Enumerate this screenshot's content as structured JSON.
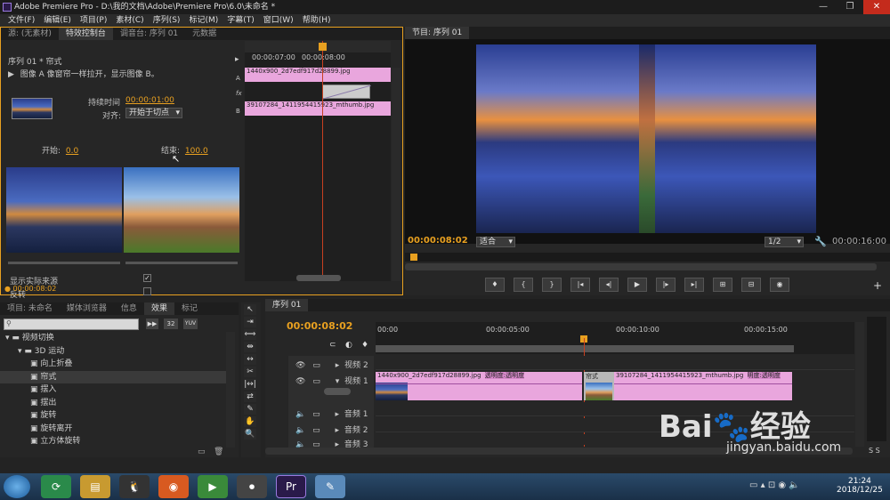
{
  "app": {
    "title": "Adobe Premiere Pro - D:\\我的文档\\Adobe\\Premiere Pro\\6.0\\未命名 *",
    "window_buttons": [
      "—",
      "❐",
      "✕"
    ]
  },
  "menu": [
    "文件(F)",
    "编辑(E)",
    "项目(P)",
    "素材(C)",
    "序列(S)",
    "标记(M)",
    "字幕(T)",
    "窗口(W)",
    "帮助(H)"
  ],
  "left_tabs": [
    "源: (无素材)",
    "特效控制台",
    "调音台: 序列 01",
    "元数据"
  ],
  "effect_controls": {
    "sequence_label": "序列 01 * 帘式",
    "description": "图像 A 像窗帘一样拉开，显示图像 B。",
    "duration_label": "持续时间",
    "duration_value": "00:00:01:00",
    "align_label": "对齐:",
    "align_value": "开始于切点",
    "start_label": "开始:",
    "start_value": "0.0",
    "end_label": "结束:",
    "end_value": "100.0",
    "show_source_label": "显示实际来源",
    "reverse_label": "反转",
    "timecode": "00:00:08:02",
    "ruler": [
      "00:00:07:00",
      "00:00:08:00"
    ],
    "clip_a": "1440x900_2d7edf917d28899.jpg",
    "clip_b": "39107284_1411954415923_mthumb.jpg",
    "track_letters": [
      "A",
      "fx",
      "B"
    ]
  },
  "program": {
    "tab": "节目: 序列 01",
    "timecode": "00:00:08:02",
    "fit": "适合",
    "quality": "1/2",
    "duration": "00:00:16:00",
    "transport": [
      "♦",
      "{",
      "}",
      "|◂",
      "◂|",
      "▶",
      "|▸",
      "▸|",
      "⊞",
      "⊟",
      "◉"
    ]
  },
  "project": {
    "tabs": [
      "项目: 未命名",
      "媒体浏览器",
      "信息",
      "效果",
      "标记"
    ],
    "tree": [
      {
        "label": "视频切换",
        "level": 0,
        "type": "folder"
      },
      {
        "label": "3D 运动",
        "level": 1,
        "type": "folder"
      },
      {
        "label": "向上折叠",
        "level": 2,
        "type": "fx"
      },
      {
        "label": "帘式",
        "level": 2,
        "type": "fx",
        "selected": true
      },
      {
        "label": "摆入",
        "level": 2,
        "type": "fx"
      },
      {
        "label": "摆出",
        "level": 2,
        "type": "fx"
      },
      {
        "label": "旋转",
        "level": 2,
        "type": "fx"
      },
      {
        "label": "旋转离开",
        "level": 2,
        "type": "fx"
      },
      {
        "label": "立方体旋转",
        "level": 2,
        "type": "fx"
      }
    ],
    "badges": [
      "32",
      "YUV"
    ]
  },
  "timeline": {
    "tab": "序列 01",
    "timecode": "00:00:08:02",
    "ruler": [
      "00:00",
      "00:00:05:00",
      "00:00:10:00",
      "00:00:15:00"
    ],
    "tracks": [
      "视频 2",
      "视频 1",
      "音频 1",
      "音频 2",
      "音频 3"
    ],
    "clip1_name": "1440x900_2d7edf917d28899.jpg",
    "clip1_fx": "透明度:透明度",
    "transition": "帘式",
    "clip2_name": "39107284_1411954415923_mthumb.jpg",
    "clip2_fx": "明度:透明度"
  },
  "taskbar": {
    "time": "21:24",
    "date": "2018/12/25",
    "pr_label": "Pr"
  },
  "watermark": {
    "brand": "Bai",
    "brand2": "经验",
    "url": "jingyan.baidu.com"
  }
}
